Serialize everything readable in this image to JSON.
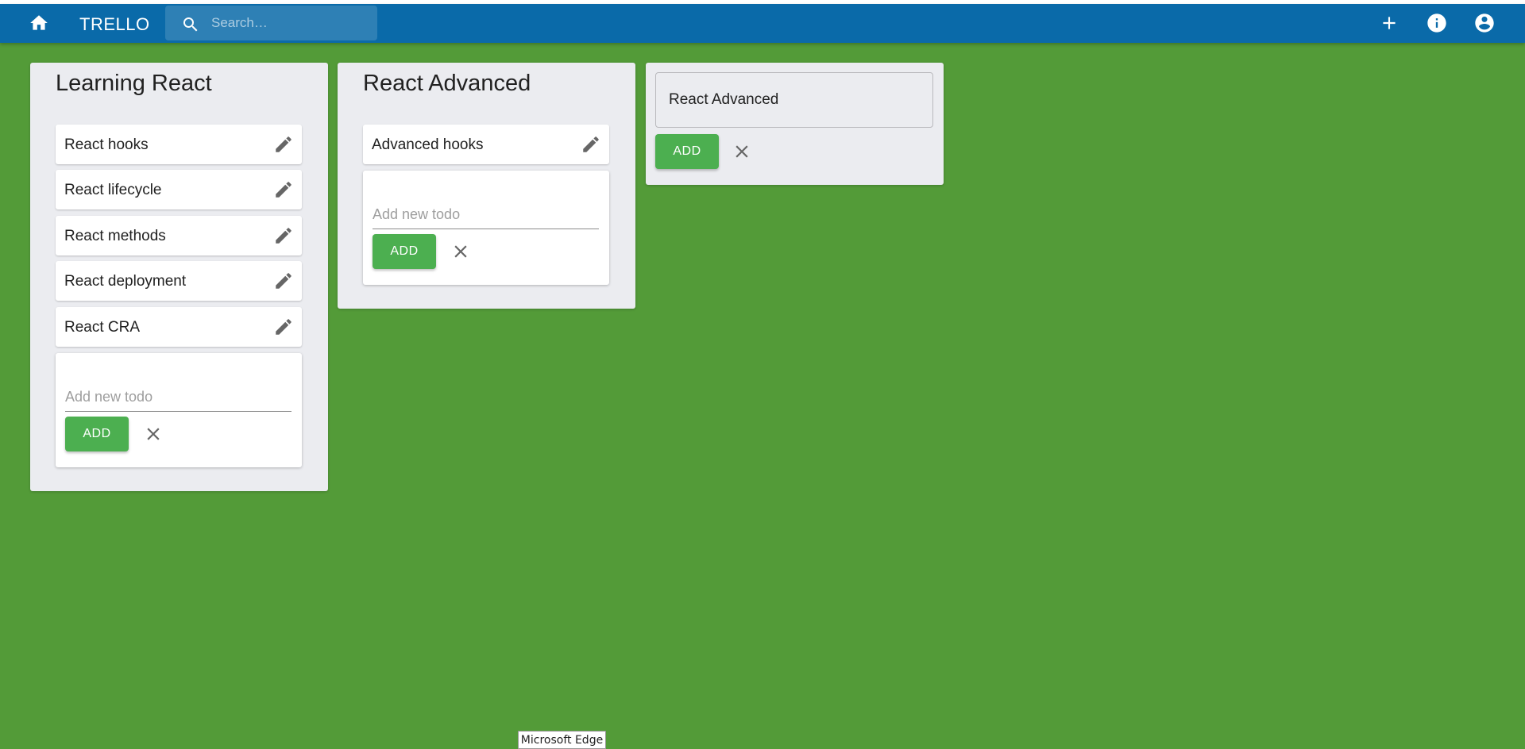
{
  "app": {
    "title": "TRELLO",
    "search_placeholder": "Search…",
    "icons": {
      "home": "home-icon",
      "search": "search-icon",
      "add": "plus-icon",
      "info": "info-icon",
      "account": "account-circle-icon"
    }
  },
  "colors": {
    "background": "#539b38",
    "appbar": "#0a6aa9",
    "list_bg": "#ebecf0",
    "add_button": "#4caf50"
  },
  "lists": [
    {
      "title": "Learning React",
      "cards": [
        "React hooks",
        "React lifecycle",
        "React methods",
        "React deployment",
        "React CRA"
      ],
      "new_todo_placeholder": "Add new todo",
      "add_label": "ADD"
    },
    {
      "title": "React Advanced",
      "cards": [
        "Advanced hooks"
      ],
      "new_todo_placeholder": "Add new todo",
      "add_label": "ADD"
    }
  ],
  "new_list_form": {
    "value": "React Advanced",
    "add_label": "ADD"
  },
  "tooltip": "Microsoft Edge"
}
